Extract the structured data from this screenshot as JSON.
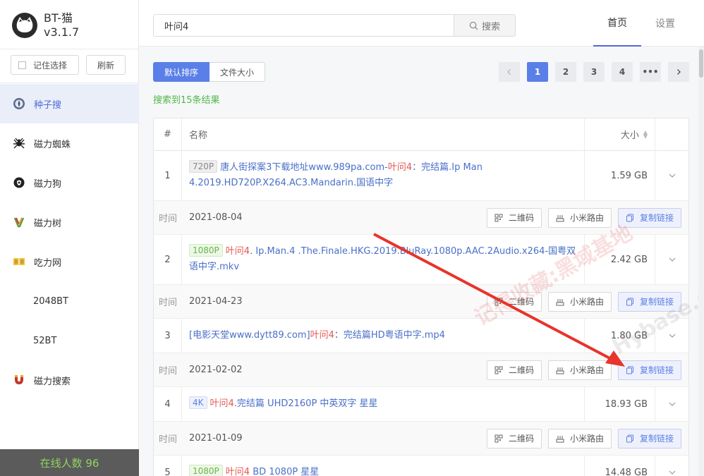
{
  "app": {
    "name": "BT-猫",
    "version": "v3.1.7"
  },
  "sidebar": {
    "remember_label": "记住选择",
    "refresh_label": "刷新",
    "items": [
      {
        "label": "种子搜",
        "icon": "compass-icon",
        "active": true
      },
      {
        "label": "磁力蜘蛛",
        "icon": "spider-icon"
      },
      {
        "label": "磁力狗",
        "icon": "dog-icon"
      },
      {
        "label": "磁力树",
        "icon": "tree-icon"
      },
      {
        "label": "吃力网",
        "icon": "book-icon"
      },
      {
        "label": "2048BT",
        "icon": ""
      },
      {
        "label": "52BT",
        "icon": ""
      },
      {
        "label": "磁力搜索",
        "icon": "magnet-icon"
      }
    ],
    "online_label": "在线人数 96"
  },
  "header": {
    "search_value": "叶问4",
    "search_button": "搜索",
    "tabs": [
      {
        "label": "首页",
        "active": true
      },
      {
        "label": "设置"
      }
    ]
  },
  "toolbar": {
    "sort_default": "默认排序",
    "sort_size": "文件大小"
  },
  "pagination": {
    "pages": [
      "1",
      "2",
      "3",
      "4"
    ],
    "current": "1",
    "ellipsis": "•••"
  },
  "result_count": "搜索到15条结果",
  "table": {
    "headers": {
      "index": "#",
      "name": "名称",
      "size": "大小"
    },
    "meta_label": "时间",
    "actions": {
      "qr": "二维码",
      "router": "小米路由",
      "copy": "复制链接"
    },
    "rows": [
      {
        "index": "1",
        "tag": "720P",
        "name_before": "唐人街探案3下载地址www.989pa.com-",
        "keyword": "叶问4",
        "name_after": "：完结篇.Ip Man 4.2019.HD720P.X264.AC3.Mandarin.国语中字",
        "size": "1.59 GB",
        "date": "2021-08-04"
      },
      {
        "index": "2",
        "tag": "1080P",
        "name_before": "",
        "keyword": "叶问4",
        "name_after": ". Ip.Man.4 .The.Finale.HKG.2019.BluRay.1080p.AAC.2Audio.x264-国粤双语中字.mkv",
        "size": "2.42 GB",
        "date": "2021-04-23"
      },
      {
        "index": "3",
        "tag": "",
        "name_before": "[电影天堂www.dytt89.com]",
        "keyword": "叶问4",
        "name_after": "：完结篇HD粤语中字.mp4",
        "size": "1.80 GB",
        "date": "2021-02-02"
      },
      {
        "index": "4",
        "tag": "4K",
        "name_before": "",
        "keyword": "叶问4",
        "name_after": ".完结篇 UHD2160P 中英双字 星星",
        "size": "18.93 GB",
        "date": "2021-01-09"
      },
      {
        "index": "5",
        "tag": "1080P",
        "name_before": "",
        "keyword": "叶问4",
        "name_after": " BD 1080P 星星",
        "size": "14.48 GB",
        "date": ""
      }
    ]
  },
  "watermark": {
    "text_cn": "记得收藏:黑域基地",
    "text_en": "Hybase.com"
  },
  "colors": {
    "accent": "#5b7fe8",
    "keyword": "#e4574f",
    "success": "#52b74a",
    "online_bg": "#5b5b5b",
    "annotation_arrow": "#e8342a"
  }
}
